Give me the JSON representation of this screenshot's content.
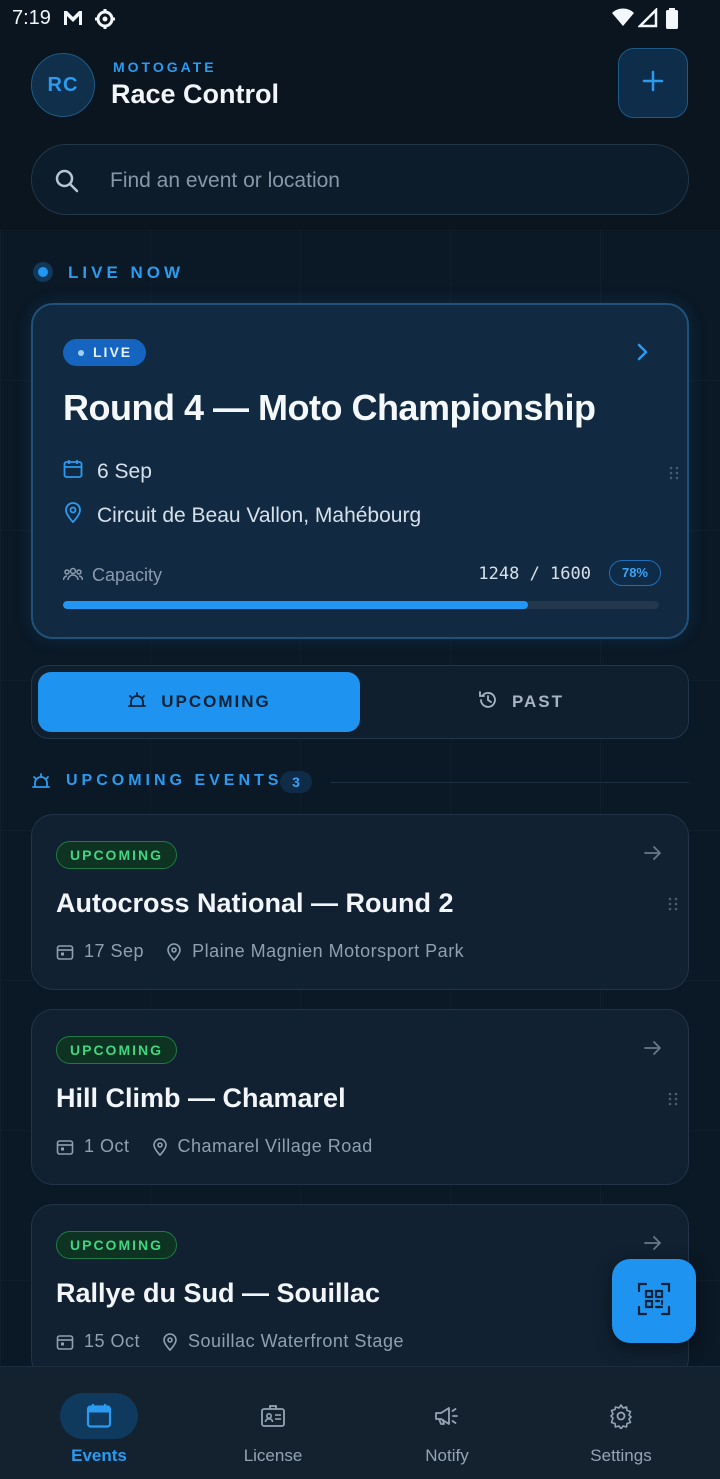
{
  "status_bar": {
    "time": "7:19"
  },
  "header": {
    "avatar_initials": "RC",
    "brand": "MOTOGATE",
    "title": "Race Control"
  },
  "search": {
    "placeholder": "Find an event or location",
    "value": ""
  },
  "live_section": {
    "title": "LIVE NOW",
    "card": {
      "badge": "LIVE",
      "title": "Round 4 — Moto Championship",
      "date": "6 Sep",
      "location": "Circuit de Beau Vallon, Mahébourg",
      "capacity_label": "Capacity",
      "capacity_value": "1248 / 1600",
      "capacity_percent_label": "78%",
      "capacity_fraction": 0.78
    }
  },
  "segment": {
    "active_label": "UPCOMING",
    "inactive_label": "PAST"
  },
  "upcoming": {
    "title": "UPCOMING EVENTS",
    "count": "3",
    "events": [
      {
        "badge": "UPCOMING",
        "title": "Autocross National — Round 2",
        "date": "17 Sep",
        "location": "Plaine Magnien Motorsport Park"
      },
      {
        "badge": "UPCOMING",
        "title": "Hill Climb — Chamarel",
        "date": "1 Oct",
        "location": "Chamarel Village Road"
      },
      {
        "badge": "UPCOMING",
        "title": "Rallye du Sud — Souillac",
        "date": "15 Oct",
        "location": "Souillac Waterfront Stage"
      }
    ]
  },
  "bottom_nav": [
    {
      "label": "Events",
      "icon": "calendar-icon",
      "active": true
    },
    {
      "label": "License",
      "icon": "id-card-icon",
      "active": false
    },
    {
      "label": "Notify",
      "icon": "megaphone-icon",
      "active": false
    },
    {
      "label": "Settings",
      "icon": "gear-icon",
      "active": false
    }
  ],
  "colors": {
    "accent": "#2196f3",
    "background": "#0b1825",
    "live_badge": "#1565c0",
    "upcoming_green": "#3fd77f"
  }
}
